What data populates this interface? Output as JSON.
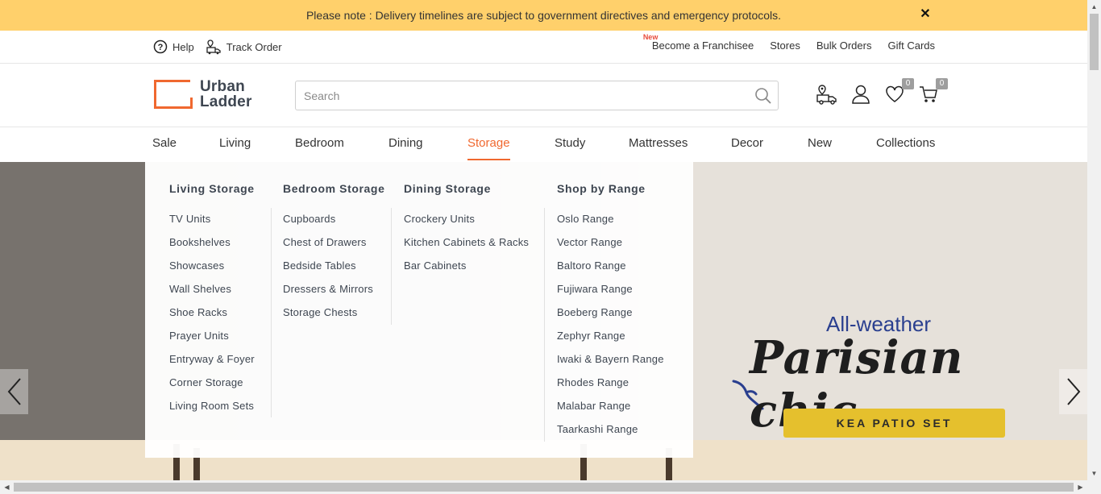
{
  "notice": {
    "text": "Please note : Delivery timelines are subject to government directives and emergency protocols.",
    "close": "✕"
  },
  "utility": {
    "help": "Help",
    "track_order": "Track Order",
    "new_tag": "New",
    "franchise": "Become a Franchisee",
    "stores": "Stores",
    "bulk_orders": "Bulk Orders",
    "gift_cards": "Gift Cards"
  },
  "header": {
    "logo_line1": "Urban",
    "logo_line2": "Ladder",
    "search_placeholder": "Search",
    "wishlist_count": "0",
    "cart_count": "0"
  },
  "nav": [
    {
      "label": "Sale"
    },
    {
      "label": "Living"
    },
    {
      "label": "Bedroom"
    },
    {
      "label": "Dining"
    },
    {
      "label": "Storage"
    },
    {
      "label": "Study"
    },
    {
      "label": "Mattresses"
    },
    {
      "label": "Decor"
    },
    {
      "label": "New"
    },
    {
      "label": "Collections"
    }
  ],
  "mega": {
    "living": {
      "title": "Living Storage",
      "items": [
        "TV Units",
        "Bookshelves",
        "Showcases",
        "Wall Shelves",
        "Shoe Racks",
        "Prayer Units",
        "Entryway & Foyer",
        "Corner Storage",
        "Living Room Sets"
      ]
    },
    "bedroom": {
      "title": "Bedroom Storage",
      "items": [
        "Cupboards",
        "Chest of Drawers",
        "Bedside Tables",
        "Dressers & Mirrors",
        "Storage Chests"
      ]
    },
    "dining": {
      "title": "Dining Storage",
      "items": [
        "Crockery Units",
        "Kitchen Cabinets & Racks",
        "Bar Cabinets"
      ]
    },
    "range": {
      "title": "Shop by Range",
      "items": [
        "Oslo Range",
        "Vector Range",
        "Baltoro Range",
        "Fujiwara Range",
        "Boeberg Range",
        "Zephyr Range",
        "Iwaki & Bayern Range",
        "Rhodes Range",
        "Malabar Range",
        "Taarkashi Range"
      ]
    }
  },
  "hero": {
    "subtitle": "All-weather",
    "title": "Parisian chic",
    "ribbon": "KEA PATIO SET"
  },
  "colors": {
    "accent": "#f0682f",
    "notice_bg": "#ffd06b",
    "text": "#3e4651"
  }
}
